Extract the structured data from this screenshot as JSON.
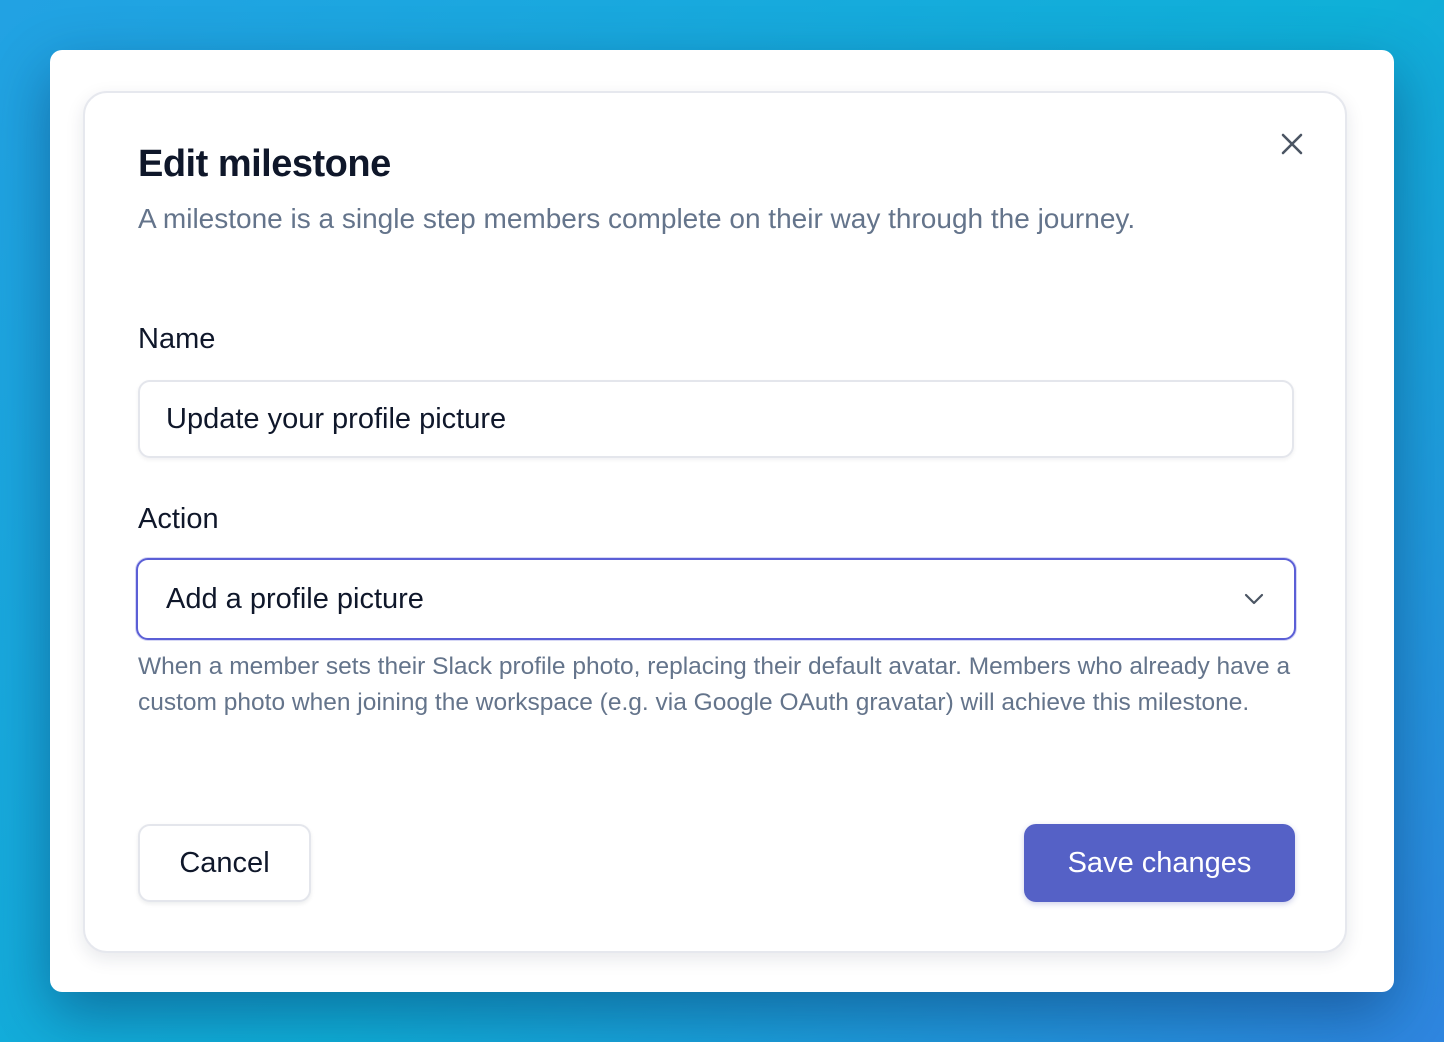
{
  "dialog": {
    "title": "Edit milestone",
    "subtitle": "A milestone is a single step members complete on their way through the journey.",
    "close_icon": "close-icon"
  },
  "form": {
    "name": {
      "label": "Name",
      "value": "Update your profile picture"
    },
    "action": {
      "label": "Action",
      "selected": "Add a profile picture",
      "dropdown_icon": "chevron-down-icon",
      "help_text": "When a member sets their Slack profile photo, replacing their default avatar. Members who already have a custom photo when joining the workspace (e.g. via Google OAuth gravatar) will achieve this milestone."
    }
  },
  "buttons": {
    "cancel_label": "Cancel",
    "save_label": "Save changes"
  },
  "colors": {
    "primary": "#5561c6",
    "focus_border": "#5b5fd6",
    "muted_text": "#64748b",
    "heading_text": "#0f172a"
  }
}
